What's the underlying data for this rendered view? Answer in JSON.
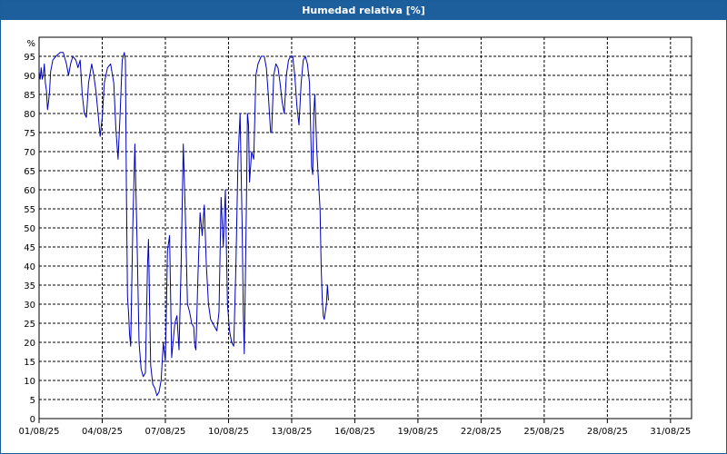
{
  "window": {
    "title": "Humedad relativa [%]"
  },
  "chart_data": {
    "type": "line",
    "title": "Humedad relativa [%]",
    "ylabel": "%",
    "xlabel": "",
    "ylim": [
      0,
      100
    ],
    "yticks": [
      0,
      5,
      10,
      15,
      20,
      25,
      30,
      35,
      40,
      45,
      50,
      55,
      60,
      65,
      70,
      75,
      80,
      85,
      90,
      95
    ],
    "xlim": [
      1,
      32
    ],
    "xticks": [
      {
        "day": 1,
        "label": "01/08/25"
      },
      {
        "day": 4,
        "label": "04/08/25"
      },
      {
        "day": 7,
        "label": "07/08/25"
      },
      {
        "day": 10,
        "label": "10/08/25"
      },
      {
        "day": 13,
        "label": "13/08/25"
      },
      {
        "day": 16,
        "label": "16/08/25"
      },
      {
        "day": 19,
        "label": "19/08/25"
      },
      {
        "day": 22,
        "label": "22/08/25"
      },
      {
        "day": 25,
        "label": "25/08/25"
      },
      {
        "day": 28,
        "label": "28/08/25"
      },
      {
        "day": 31,
        "label": "31/08/25"
      }
    ],
    "grid": true,
    "series_color": "#0000bb",
    "series": [
      {
        "points": [
          [
            1.0,
            91
          ],
          [
            1.05,
            89
          ],
          [
            1.1,
            92
          ],
          [
            1.15,
            89
          ],
          [
            1.2,
            90
          ],
          [
            1.25,
            93
          ],
          [
            1.3,
            88
          ],
          [
            1.35,
            86
          ],
          [
            1.4,
            81
          ],
          [
            1.45,
            83
          ],
          [
            1.5,
            86
          ],
          [
            1.55,
            91
          ],
          [
            1.65,
            94
          ],
          [
            1.8,
            95
          ],
          [
            2.0,
            96
          ],
          [
            2.15,
            96
          ],
          [
            2.3,
            93
          ],
          [
            2.4,
            90
          ],
          [
            2.5,
            93
          ],
          [
            2.6,
            95
          ],
          [
            2.75,
            94
          ],
          [
            2.85,
            92
          ],
          [
            2.95,
            94
          ],
          [
            3.05,
            85
          ],
          [
            3.15,
            80
          ],
          [
            3.25,
            79
          ],
          [
            3.35,
            88
          ],
          [
            3.5,
            93
          ],
          [
            3.6,
            90
          ],
          [
            3.7,
            86
          ],
          [
            3.8,
            80
          ],
          [
            3.9,
            74
          ],
          [
            4.0,
            79
          ],
          [
            4.1,
            88
          ],
          [
            4.25,
            92
          ],
          [
            4.4,
            93
          ],
          [
            4.55,
            88
          ],
          [
            4.65,
            76
          ],
          [
            4.75,
            68
          ],
          [
            4.85,
            80
          ],
          [
            4.95,
            94
          ],
          [
            5.05,
            96
          ],
          [
            5.1,
            94
          ],
          [
            5.15,
            60
          ],
          [
            5.2,
            32
          ],
          [
            5.25,
            28
          ],
          [
            5.3,
            22
          ],
          [
            5.35,
            19
          ],
          [
            5.45,
            50
          ],
          [
            5.55,
            72
          ],
          [
            5.65,
            48
          ],
          [
            5.75,
            20
          ],
          [
            5.85,
            13
          ],
          [
            5.95,
            11
          ],
          [
            6.05,
            12
          ],
          [
            6.15,
            40
          ],
          [
            6.2,
            47
          ],
          [
            6.3,
            14
          ],
          [
            6.4,
            9
          ],
          [
            6.5,
            8
          ],
          [
            6.6,
            6
          ],
          [
            6.7,
            7
          ],
          [
            6.8,
            10
          ],
          [
            6.9,
            20
          ],
          [
            7.0,
            15
          ],
          [
            7.1,
            44
          ],
          [
            7.2,
            48
          ],
          [
            7.3,
            16
          ],
          [
            7.45,
            25
          ],
          [
            7.55,
            27
          ],
          [
            7.65,
            18
          ],
          [
            7.75,
            40
          ],
          [
            7.85,
            72
          ],
          [
            7.95,
            53
          ],
          [
            8.05,
            30
          ],
          [
            8.15,
            28
          ],
          [
            8.25,
            25
          ],
          [
            8.35,
            24
          ],
          [
            8.4,
            19
          ],
          [
            8.45,
            18
          ],
          [
            8.55,
            38
          ],
          [
            8.65,
            54
          ],
          [
            8.75,
            48
          ],
          [
            8.85,
            56
          ],
          [
            8.95,
            40
          ],
          [
            9.05,
            30
          ],
          [
            9.15,
            26
          ],
          [
            9.25,
            25
          ],
          [
            9.35,
            24
          ],
          [
            9.45,
            23
          ],
          [
            9.55,
            28
          ],
          [
            9.65,
            58
          ],
          [
            9.75,
            45
          ],
          [
            9.85,
            60
          ],
          [
            9.95,
            30
          ],
          [
            10.05,
            23
          ],
          [
            10.15,
            20
          ],
          [
            10.25,
            19
          ],
          [
            10.35,
            40
          ],
          [
            10.45,
            68
          ],
          [
            10.55,
            80
          ],
          [
            10.65,
            50
          ],
          [
            10.7,
            28
          ],
          [
            10.75,
            17
          ],
          [
            10.85,
            55
          ],
          [
            10.9,
            80
          ],
          [
            10.95,
            77
          ],
          [
            11.0,
            62
          ],
          [
            11.1,
            70
          ],
          [
            11.2,
            68
          ],
          [
            11.3,
            90
          ],
          [
            11.4,
            93
          ],
          [
            11.55,
            95
          ],
          [
            11.7,
            95
          ],
          [
            11.8,
            92
          ],
          [
            11.9,
            84
          ],
          [
            12.0,
            75
          ],
          [
            12.05,
            75
          ],
          [
            12.15,
            90
          ],
          [
            12.25,
            93
          ],
          [
            12.35,
            92
          ],
          [
            12.45,
            88
          ],
          [
            12.55,
            83
          ],
          [
            12.65,
            80
          ],
          [
            12.75,
            90
          ],
          [
            12.85,
            94
          ],
          [
            12.95,
            95
          ],
          [
            13.05,
            95
          ],
          [
            13.15,
            90
          ],
          [
            13.25,
            82
          ],
          [
            13.35,
            77
          ],
          [
            13.45,
            88
          ],
          [
            13.55,
            94
          ],
          [
            13.65,
            95
          ],
          [
            13.75,
            93
          ],
          [
            13.85,
            88
          ],
          [
            13.95,
            66
          ],
          [
            14.0,
            64
          ],
          [
            14.05,
            80
          ],
          [
            14.1,
            85
          ],
          [
            14.2,
            70
          ],
          [
            14.3,
            60
          ],
          [
            14.35,
            55
          ],
          [
            14.4,
            40
          ],
          [
            14.45,
            32
          ],
          [
            14.5,
            27
          ],
          [
            14.55,
            26
          ],
          [
            14.65,
            30
          ],
          [
            14.7,
            35
          ],
          [
            14.75,
            31
          ]
        ]
      }
    ]
  }
}
